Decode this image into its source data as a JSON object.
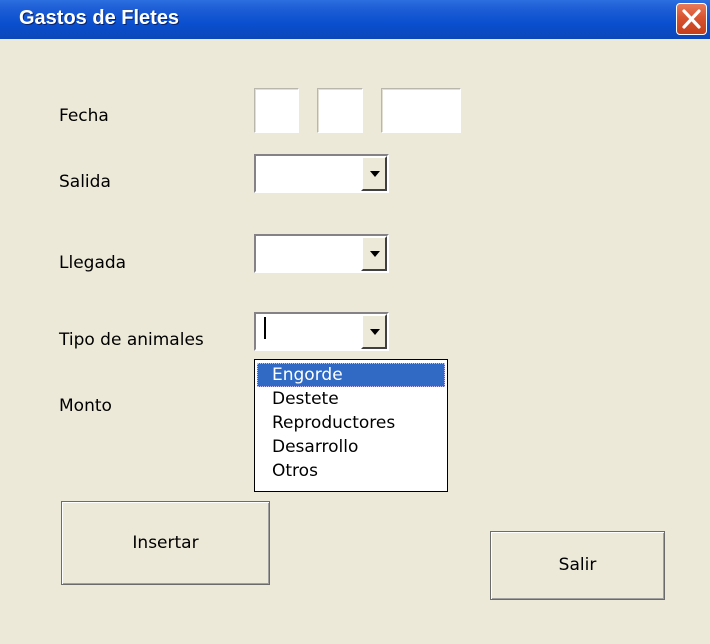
{
  "window": {
    "title": "Gastos de Fletes",
    "close_icon": "close-icon"
  },
  "labels": {
    "fecha": "Fecha",
    "salida": "Salida",
    "llegada": "Llegada",
    "tipo": "Tipo de animales",
    "monto": "Monto"
  },
  "fecha": {
    "day": "",
    "month": "",
    "year": ""
  },
  "salida": {
    "value": ""
  },
  "llegada": {
    "value": ""
  },
  "tipo_animales": {
    "value": "",
    "options": [
      "Engorde",
      "Destete",
      "Reproductores",
      "Desarrollo",
      "Otros"
    ],
    "highlighted": "Engorde"
  },
  "buttons": {
    "insertar": "Insertar",
    "salir": "Salir"
  },
  "colors": {
    "title_bar": "#0a4fcf",
    "dialog_bg": "#ece9d8",
    "selection": "#316ac5",
    "close_button": "#d8532f"
  }
}
